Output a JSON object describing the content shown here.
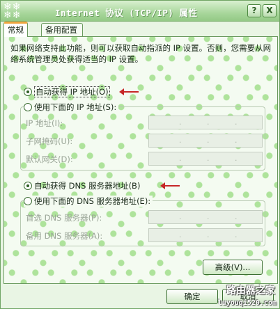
{
  "window": {
    "title": "Internet 协议 (TCP/IP) 属性",
    "help_label": "?",
    "close_label": "X"
  },
  "tabs": [
    {
      "label": "常规"
    },
    {
      "label": "备用配置"
    }
  ],
  "description": "如果网络支持此功能，则可以获取自动指派的 IP 设置。否则，您需要从网络系统管理员处获得适当的 IP 设置。",
  "ip_section": {
    "auto_label": "自动获得 IP 地址(O)",
    "auto_checked": true,
    "manual_label": "使用下面的 IP 地址(S):",
    "manual_checked": false,
    "fields": [
      {
        "label": "IP 地址(I):"
      },
      {
        "label": "子网掩码(U):"
      },
      {
        "label": "默认网关(D):"
      }
    ]
  },
  "dns_section": {
    "auto_label": "自动获得 DNS 服务器地址(B)",
    "auto_checked": true,
    "manual_label": "使用下面的 DNS 服务器地址(E):",
    "manual_checked": false,
    "fields": [
      {
        "label": "首选 DNS 服务器(P):"
      },
      {
        "label": "备用 DNS 服务器(A):"
      }
    ]
  },
  "buttons": {
    "advanced": "高级(V)...",
    "ok": "确定",
    "cancel": "取消"
  },
  "watermark": {
    "line1": "路由器之家",
    "line2": "luyouqi520.com"
  },
  "colors": {
    "accent_green": "#93c985",
    "arrow_red": "#c62626",
    "tab_highlight": "#f0a640"
  }
}
